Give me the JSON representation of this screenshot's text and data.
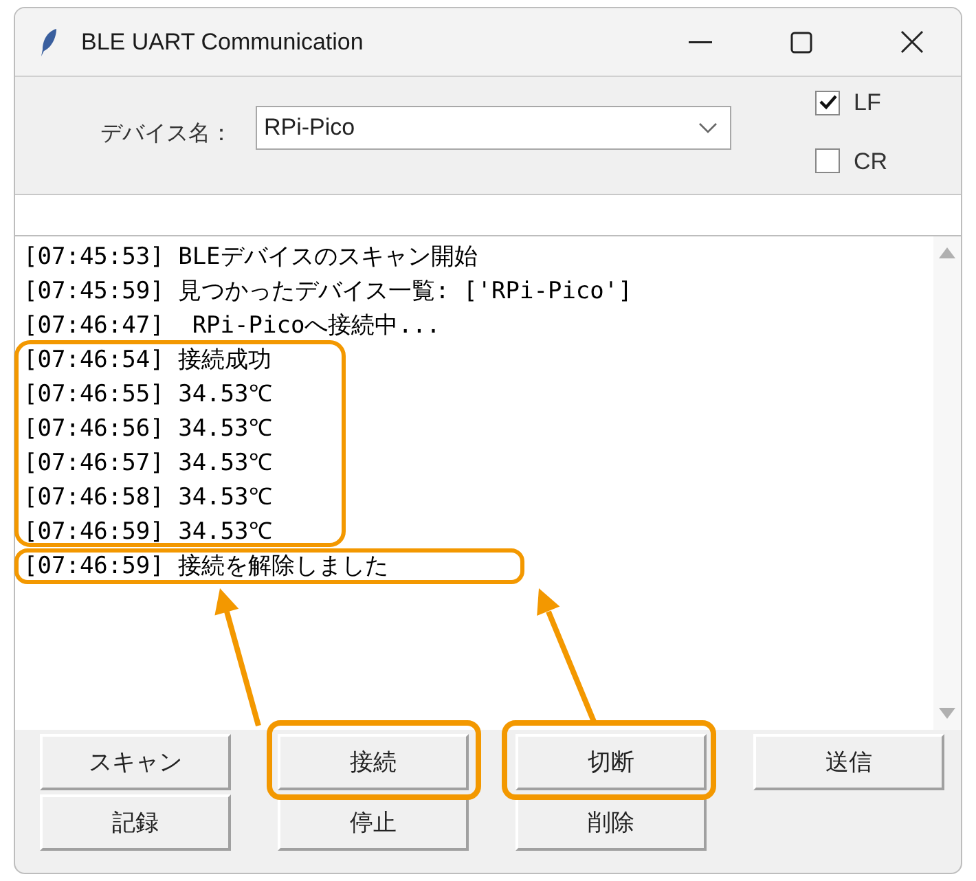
{
  "window": {
    "title": "BLE UART Communication"
  },
  "device": {
    "label": "デバイス名：",
    "value": "RPi-Pico"
  },
  "options": [
    {
      "label": "LF",
      "checked": true
    },
    {
      "label": "CR",
      "checked": false
    }
  ],
  "log": [
    "[07:45:53] BLEデバイスのスキャン開始",
    "[07:45:59] 見つかったデバイス一覧: ['RPi-Pico']",
    "[07:46:47]  RPi-Picoへ接続中...",
    "[07:46:54] 接続成功",
    "[07:46:55] 34.53℃",
    "[07:46:56] 34.53℃",
    "[07:46:57] 34.53℃",
    "[07:46:58] 34.53℃",
    "[07:46:59] 34.53℃",
    "[07:46:59] 接続を解除しました"
  ],
  "buttons": [
    [
      "スキャン",
      "接続",
      "切断",
      "送信"
    ],
    [
      "記録",
      "停止",
      "削除"
    ]
  ]
}
